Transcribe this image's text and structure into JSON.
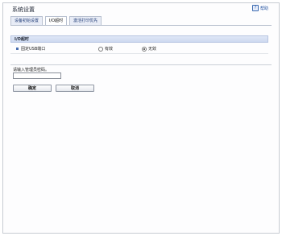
{
  "header": {
    "title": "系统设置",
    "help_label": "帮助",
    "help_icon": "help-icon"
  },
  "tabs": [
    {
      "label": "设备初始设置",
      "active": false
    },
    {
      "label": "I/O超时",
      "active": true
    },
    {
      "label": "激活打印优先",
      "active": false
    }
  ],
  "section": {
    "title": "I/O超时",
    "rows": [
      {
        "label": "固定USB端口",
        "options": [
          {
            "label": "有效",
            "selected": false
          },
          {
            "label": "无效",
            "selected": true
          }
        ]
      }
    ]
  },
  "password": {
    "label": "请输入管理员密码。",
    "value": ""
  },
  "buttons": {
    "ok": "确定",
    "cancel": "取消"
  }
}
